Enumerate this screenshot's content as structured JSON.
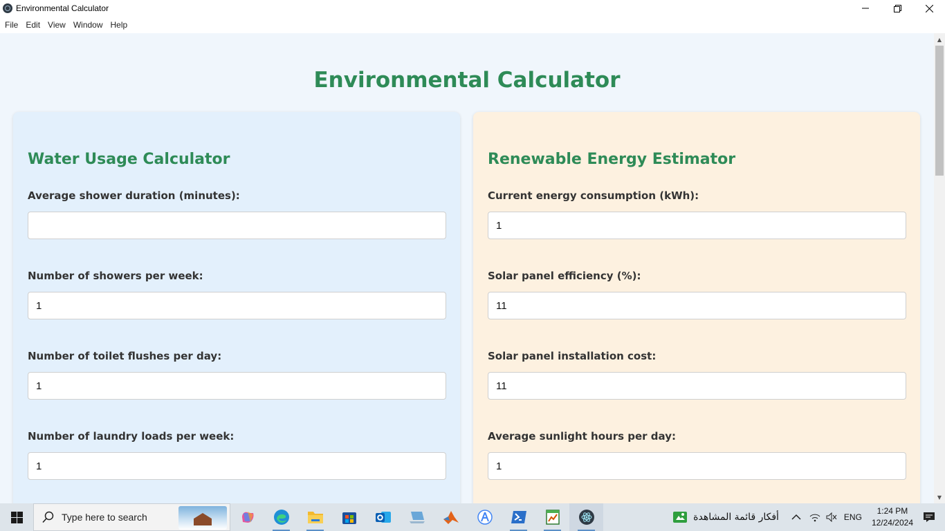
{
  "window": {
    "title": "Environmental Calculator"
  },
  "menu": [
    "File",
    "Edit",
    "View",
    "Window",
    "Help"
  ],
  "page": {
    "title": "Environmental Calculator"
  },
  "water": {
    "heading": "Water Usage Calculator",
    "fields": [
      {
        "label": "Average shower duration (minutes):",
        "value": ""
      },
      {
        "label": "Number of showers per week:",
        "value": "1"
      },
      {
        "label": "Number of toilet flushes per day:",
        "value": "1"
      },
      {
        "label": "Number of laundry loads per week:",
        "value": "1"
      }
    ]
  },
  "energy": {
    "heading": "Renewable Energy Estimator",
    "fields": [
      {
        "label": "Current energy consumption (kWh):",
        "value": "1"
      },
      {
        "label": "Solar panel efficiency (%):",
        "value": "11"
      },
      {
        "label": "Solar panel installation cost:",
        "value": "11"
      },
      {
        "label": "Average sunlight hours per day:",
        "value": "1"
      }
    ]
  },
  "taskbar": {
    "search_placeholder": "Type here to search",
    "apps": [
      "copilot-icon",
      "edge-icon",
      "file-explorer-icon",
      "store-icon",
      "outlook-icon",
      "computer-icon",
      "matlab-icon",
      "android-studio-icon",
      "powershell-icon",
      "notepad-icon",
      "electron-icon"
    ],
    "news_text": "أفكار قائمة المشاهدة",
    "language": "ENG",
    "time": "1:24 PM",
    "date": "12/24/2024"
  },
  "colors": {
    "accent": "#2e8b57",
    "water_bg": "#e3f0fc",
    "energy_bg": "#fdf1e0"
  }
}
